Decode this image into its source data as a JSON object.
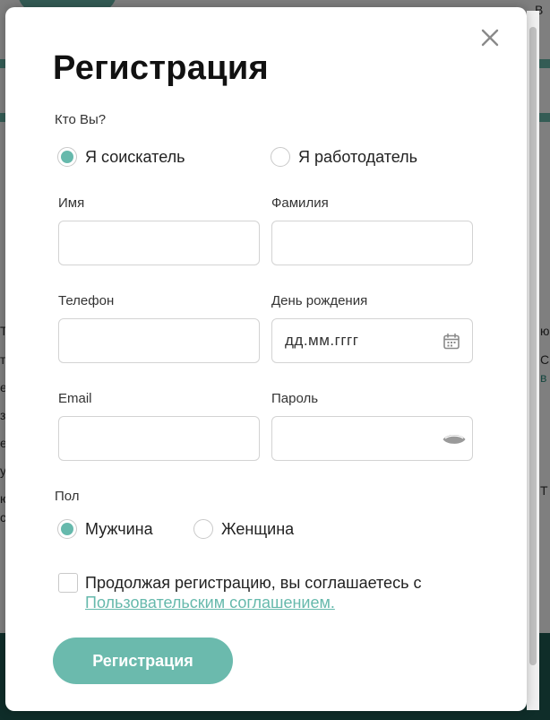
{
  "colors": {
    "accent": "#66b9ac",
    "button": "#6bbaad",
    "text": "#222222",
    "border": "#d3d3d3"
  },
  "background_fragments": [
    "В",
    "Т",
    "т",
    "ем",
    "з",
    "е,",
    "у",
    "ю",
    "с",
    "ю",
    "С",
    "в",
    "Т"
  ],
  "modal": {
    "close_icon": "close-icon",
    "title": "Регистрация",
    "role": {
      "label": "Кто Вы?",
      "options": [
        {
          "label": "Я соискатель",
          "selected": true
        },
        {
          "label": "Я работодатель",
          "selected": false
        }
      ]
    },
    "fields": {
      "first_name": {
        "label": "Имя",
        "value": "",
        "placeholder": ""
      },
      "last_name": {
        "label": "Фамилия",
        "value": "",
        "placeholder": ""
      },
      "phone": {
        "label": "Телефон",
        "value": "",
        "placeholder": ""
      },
      "birthday": {
        "label": "День рождения",
        "value": "",
        "placeholder": "дд.мм.гггг",
        "icon": "calendar-icon"
      },
      "email": {
        "label": "Email",
        "value": "",
        "placeholder": ""
      },
      "password": {
        "label": "Пароль",
        "value": "",
        "placeholder": "",
        "icon": "eye-icon"
      }
    },
    "gender": {
      "label": "Пол",
      "options": [
        {
          "label": "Мужчина",
          "selected": true
        },
        {
          "label": "Женщина",
          "selected": false
        }
      ]
    },
    "agreement": {
      "checked": false,
      "text": "Продолжая регистрацию, вы соглашаетесь с ",
      "link": "Пользовательским соглашением."
    },
    "submit_label": "Регистрация"
  }
}
